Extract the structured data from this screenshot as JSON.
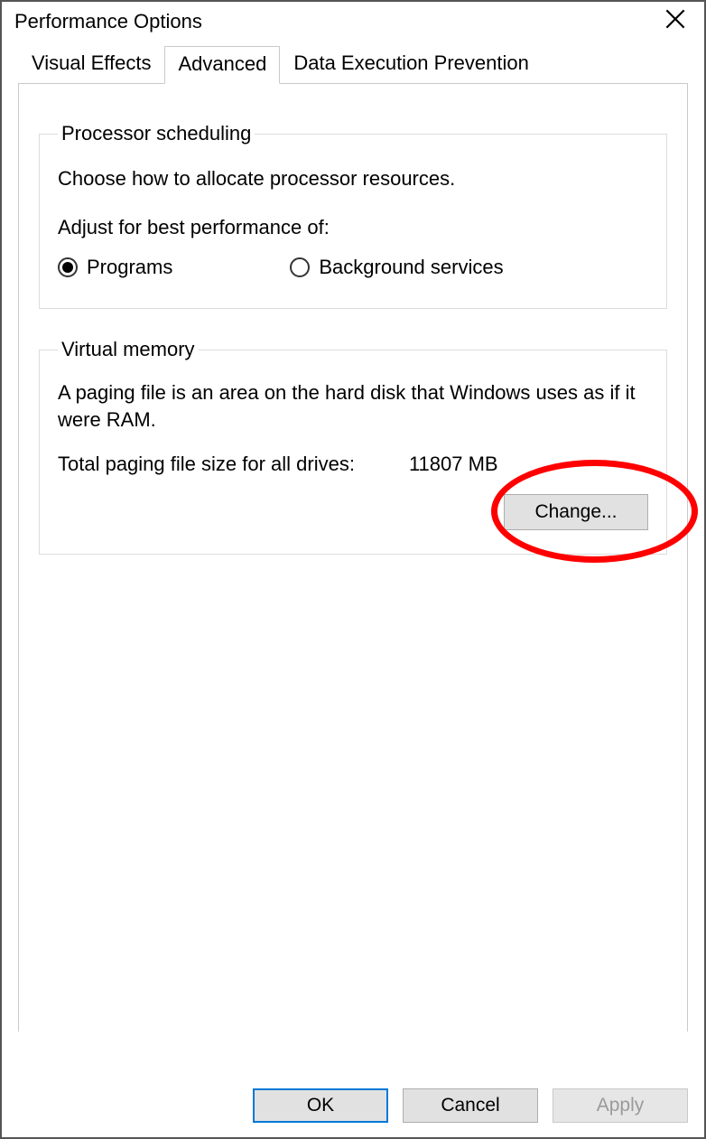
{
  "window": {
    "title": "Performance Options"
  },
  "tabs": {
    "visual_effects": "Visual Effects",
    "advanced": "Advanced",
    "dep": "Data Execution Prevention"
  },
  "processor": {
    "legend": "Processor scheduling",
    "description": "Choose how to allocate processor resources.",
    "adjust_label": "Adjust for best performance of:",
    "option_programs": "Programs",
    "option_background": "Background services",
    "selected": "programs"
  },
  "virtual_memory": {
    "legend": "Virtual memory",
    "description": "A paging file is an area on the hard disk that Windows uses as if it were RAM.",
    "total_label": "Total paging file size for all drives:",
    "total_value": "11807 MB",
    "change_button": "Change..."
  },
  "buttons": {
    "ok": "OK",
    "cancel": "Cancel",
    "apply": "Apply"
  }
}
